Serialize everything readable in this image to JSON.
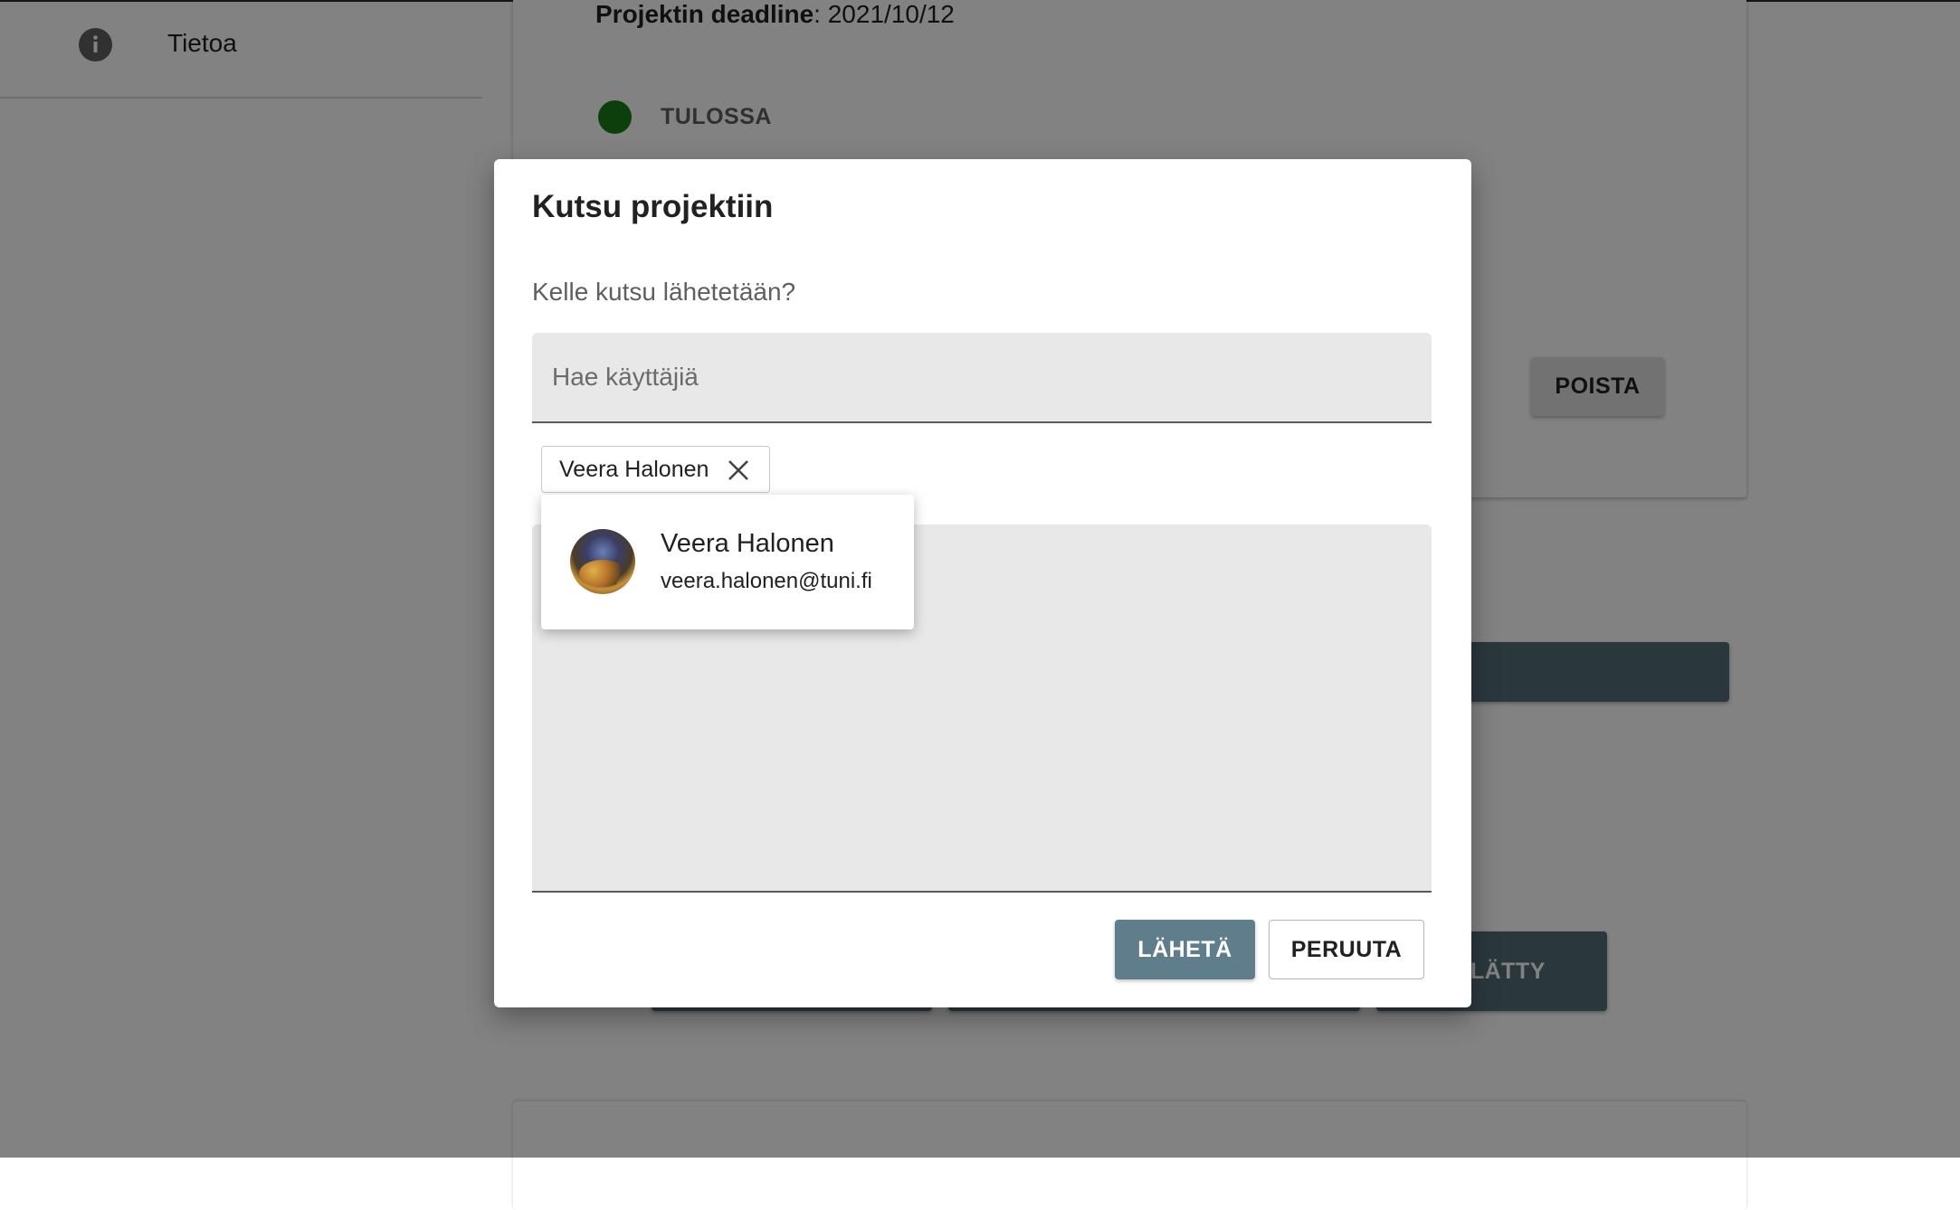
{
  "background": {
    "sidebar": {
      "items": [
        {
          "label": "Tietoa",
          "icon": "info-icon"
        }
      ]
    },
    "project": {
      "deadline_label": "Projektin deadline",
      "deadline_value": "2021/10/12",
      "status": "TULOSSA",
      "status_color": "#1b7d1b",
      "delete_label": "POISTA",
      "reject_label": "HYLÄTTY"
    },
    "scrim_color": "rgba(0,0,0,0.49)"
  },
  "dialog": {
    "title": "Kutsu projektiin",
    "question": "Kelle kutsu lähetetään?",
    "search": {
      "placeholder": "Hae käyttäjiä",
      "value": ""
    },
    "selected_chips": [
      {
        "label": "Veera Halonen"
      }
    ],
    "suggestions": [
      {
        "name": "Veera Halonen",
        "email": "veera.halonen@tuni.fi"
      }
    ],
    "message": {
      "value": ""
    },
    "actions": {
      "send_label": "LÄHETÄ",
      "cancel_label": "PERUUTA"
    },
    "colors": {
      "primary_button": "#607d8b",
      "field_background": "#e8e8e8"
    }
  }
}
